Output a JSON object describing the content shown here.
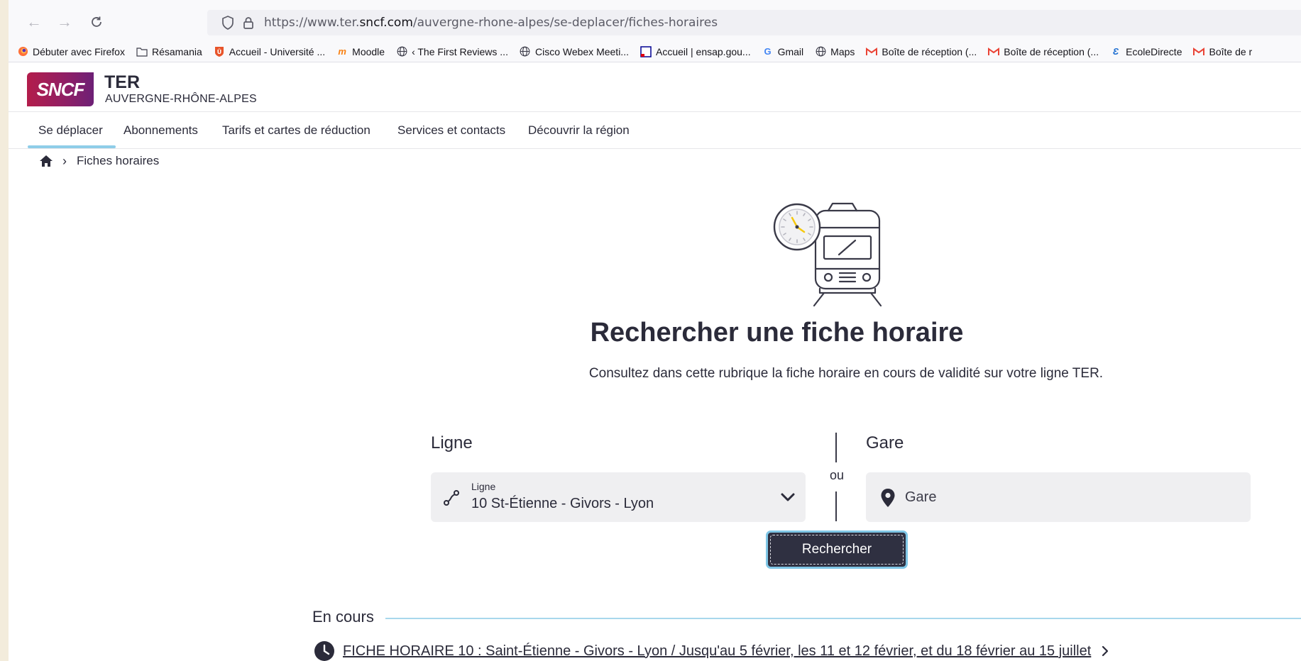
{
  "browser": {
    "url_prefix": "https://www.ter.",
    "url_domain": "sncf.com",
    "url_path": "/auvergne-rhone-alpes/se-deplacer/fiches-horaires",
    "bookmarks": [
      {
        "label": "Débuter avec Firefox",
        "icon": "firefox-icon"
      },
      {
        "label": "Résamania",
        "icon": "folder-icon"
      },
      {
        "label": "Accueil - Université ...",
        "icon": "university-shield-icon"
      },
      {
        "label": "Moodle",
        "icon": "moodle-icon"
      },
      {
        "label": "‹ The First Reviews ...",
        "icon": "globe-icon"
      },
      {
        "label": "Cisco Webex Meeti...",
        "icon": "globe-icon"
      },
      {
        "label": "Accueil | ensap.gou...",
        "icon": "ensap-icon"
      },
      {
        "label": "Gmail",
        "icon": "google-icon"
      },
      {
        "label": "Maps",
        "icon": "globe-icon"
      },
      {
        "label": "Boîte de réception (...",
        "icon": "gmail-icon"
      },
      {
        "label": "Boîte de réception (...",
        "icon": "gmail-icon"
      },
      {
        "label": "EcoleDirecte",
        "icon": "ecoledirecte-icon"
      },
      {
        "label": "Boîte de r",
        "icon": "gmail-icon"
      }
    ]
  },
  "header": {
    "logo_text": "SNCF",
    "brand": "TER",
    "region": "AUVERGNE-RHÔNE-ALPES"
  },
  "nav": {
    "items": [
      "Se déplacer",
      "Abonnements",
      "Tarifs et cartes de réduction",
      "Services et contacts",
      "Découvrir la région"
    ],
    "active": "Se déplacer"
  },
  "breadcrumb": {
    "current": "Fiches horaires"
  },
  "main": {
    "title": "Rechercher une fiche horaire",
    "subtitle": "Consultez dans cette rubrique la fiche horaire en cours de validité sur votre ligne TER.",
    "ligne_label": "Ligne",
    "ligne_select_label": "Ligne",
    "ligne_value": "10 St-Étienne - Givors - Lyon",
    "separator": "ou",
    "gare_label": "Gare",
    "gare_placeholder": "Gare",
    "search_button": "Rechercher",
    "en_cours_label": "En cours",
    "fiche_link": "FICHE HORAIRE 10 : Saint-Étienne - Givors - Lyon / Jusqu'au 5 février, les 11 et 12 février, et du 18 février au 15 juillet"
  },
  "colors": {
    "brand_gradient_start": "#b31d4b",
    "brand_gradient_end": "#6d2076",
    "button_bg": "#2f3041",
    "focus_ring": "#7fc6e6",
    "accent_line": "#a8d8ec"
  }
}
